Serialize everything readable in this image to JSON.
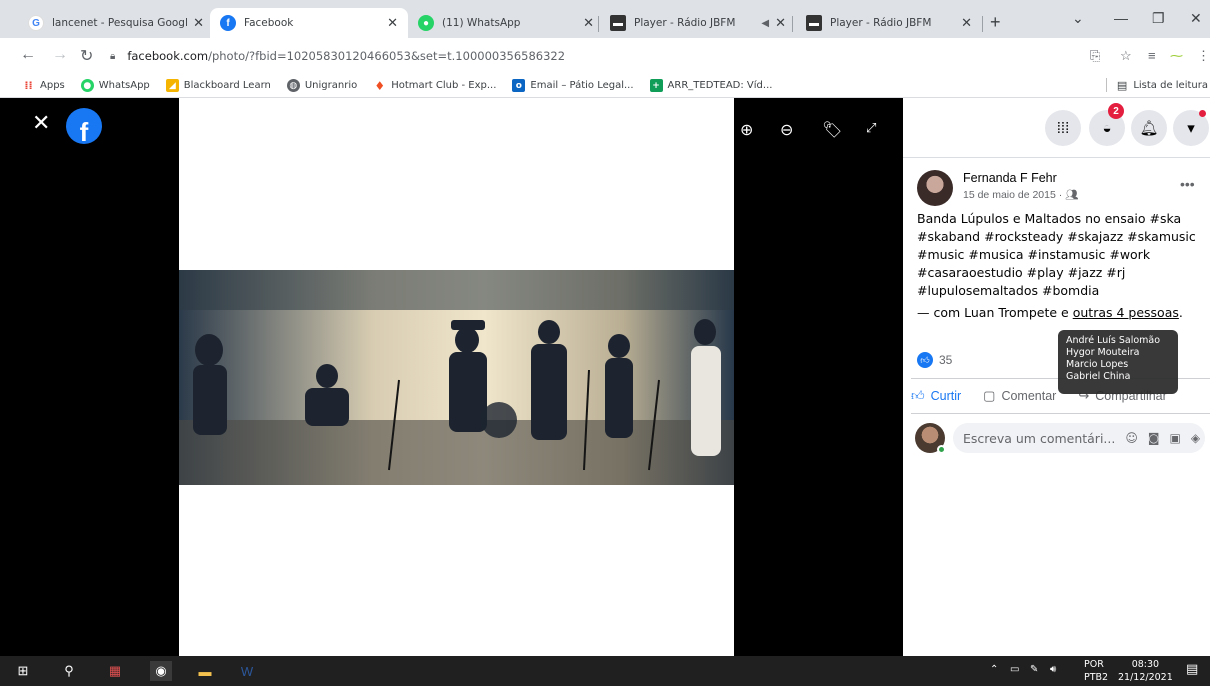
{
  "browser": {
    "tabs": [
      {
        "title": "lancenet - Pesquisa Google",
        "favicon": "google-icon",
        "color": "#4285f4",
        "glyph": "G"
      },
      {
        "title": "Facebook",
        "favicon": "facebook-icon",
        "color": "#1877f2",
        "glyph": "f"
      },
      {
        "title": "(11) WhatsApp",
        "favicon": "whatsapp-icon",
        "color": "#25d366",
        "glyph": "●"
      },
      {
        "title": "Player - Rádio JBFM",
        "favicon": "radio-icon",
        "color": "#333333",
        "glyph": "▬"
      },
      {
        "title": "Player - Rádio JBFM",
        "favicon": "radio-icon",
        "color": "#333333",
        "glyph": "▬"
      }
    ],
    "url_host": "facebook.com",
    "url_path": "/photo/?fbid=10205830120466053&set=t.100000356586322",
    "bookmarks": [
      {
        "label": "Apps",
        "icon": "apps-grid-icon",
        "color": "#ea4335",
        "glyph": "⋮⋮"
      },
      {
        "label": "WhatsApp",
        "icon": "whatsapp-icon",
        "color": "#25d366",
        "glyph": "●"
      },
      {
        "label": "Blackboard Learn",
        "icon": "blackboard-icon",
        "color": "#f4b400",
        "glyph": "◢"
      },
      {
        "label": "Unigranrio",
        "icon": "globe-icon",
        "color": "#5f6368",
        "glyph": "◍"
      },
      {
        "label": "Hotmart Club - Exp...",
        "icon": "hotmart-icon",
        "color": "#f04e23",
        "glyph": "♦"
      },
      {
        "label": "Email – Pátio Legal...",
        "icon": "outlook-icon",
        "color": "#0a66c2",
        "glyph": "o"
      },
      {
        "label": "ARR_TEDTEAD: Víd...",
        "icon": "sheet-icon",
        "color": "#0f9d58",
        "glyph": "+"
      }
    ],
    "reading_list": "Lista de leitura"
  },
  "post": {
    "author": "Fernanda F Fehr",
    "date": "15 de maio de 2015 ·",
    "caption": "Banda Lúpulos e Maltados no ensaio #ska #skaband #rocksteady #skajazz #skamusic #music #musica #instamusic #work #casaraoestudio #play #jazz #rj #lupulosemaltados #bomdia",
    "with_prefix": "— com Luan Trompete e ",
    "with_others": "outras 4 pessoas",
    "with_suffix": ".",
    "reaction_count": "35",
    "actions": {
      "like": "Curtir",
      "comment": "Comentar",
      "share": "Compartilhar"
    },
    "comment_placeholder": "Escreva um comentári...",
    "tooltip_names": [
      "André Luís Salomão",
      "Hygor Mouteira",
      "Marcio Lopes",
      "Gabriel China"
    ]
  },
  "notifications": {
    "messenger_badge": "2"
  },
  "taskbar": {
    "lang_top": "POR",
    "lang_bottom": "PTB2",
    "time": "08:30",
    "date": "21/12/2021"
  },
  "colors": {
    "facebook_blue": "#1877f2",
    "badge_red": "#e41e3f"
  }
}
